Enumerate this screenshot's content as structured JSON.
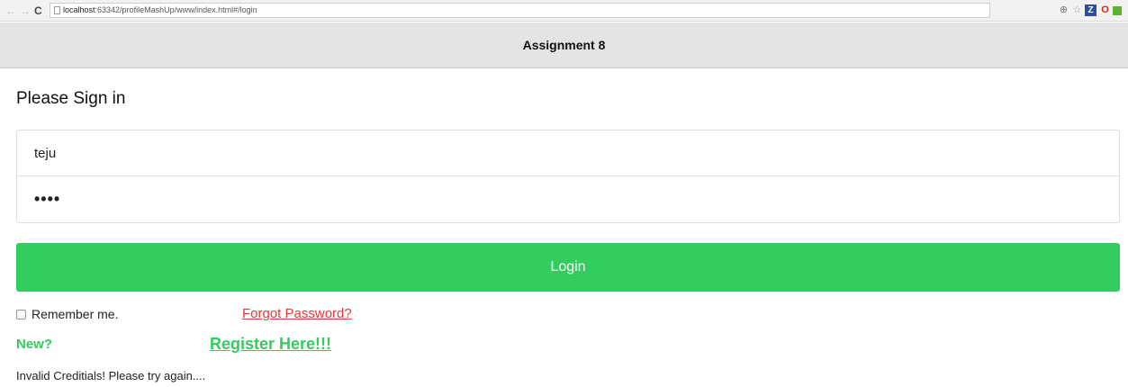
{
  "browser": {
    "url_host": "localhost",
    "url_rest": ":63342/profileMashUp/www/index.html#/login"
  },
  "header": {
    "title": "Assignment 8"
  },
  "form": {
    "heading": "Please Sign in",
    "username_value": "teju",
    "password_value": "••••",
    "login_label": "Login",
    "remember_label": "Remember me.",
    "forgot_label": "Forgot Password?",
    "new_label": "New?",
    "register_label": "Register Here!!!",
    "error_message": "Invalid Creditials! Please try again...."
  },
  "colors": {
    "accent_green": "#33cd5f",
    "link_red": "#e53935",
    "header_bg": "#e4e4e4"
  }
}
